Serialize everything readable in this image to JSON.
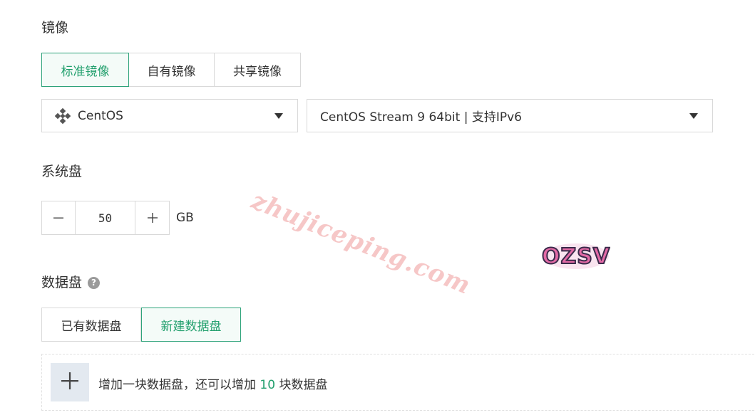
{
  "image_section": {
    "title": "镜像",
    "tabs": [
      {
        "label": "标准镜像",
        "active": true
      },
      {
        "label": "自有镜像",
        "active": false
      },
      {
        "label": "共享镜像",
        "active": false
      }
    ],
    "os_select": {
      "value": "CentOS",
      "icon": "centos-logo-icon"
    },
    "version_select": {
      "value": "CentOS Stream 9 64bit | 支持IPv6"
    }
  },
  "system_disk": {
    "title": "系统盘",
    "size": "50",
    "unit": "GB",
    "decrement_icon": "minus-icon",
    "increment_icon": "plus-icon"
  },
  "data_disk": {
    "title": "数据盘",
    "help_icon": "?",
    "tabs": [
      {
        "label": "已有数据盘",
        "active": false
      },
      {
        "label": "新建数据盘",
        "active": true
      }
    ],
    "add_prefix": "增加一块数据盘，还可以增加",
    "add_count": "10",
    "add_suffix": "块数据盘"
  },
  "watermark": {
    "text": "zhujiceping.com",
    "logo_text": "OZSV"
  },
  "colors": {
    "accent": "#23a06e",
    "border": "#d9d9d9",
    "add_bg": "#e3e9f0"
  }
}
